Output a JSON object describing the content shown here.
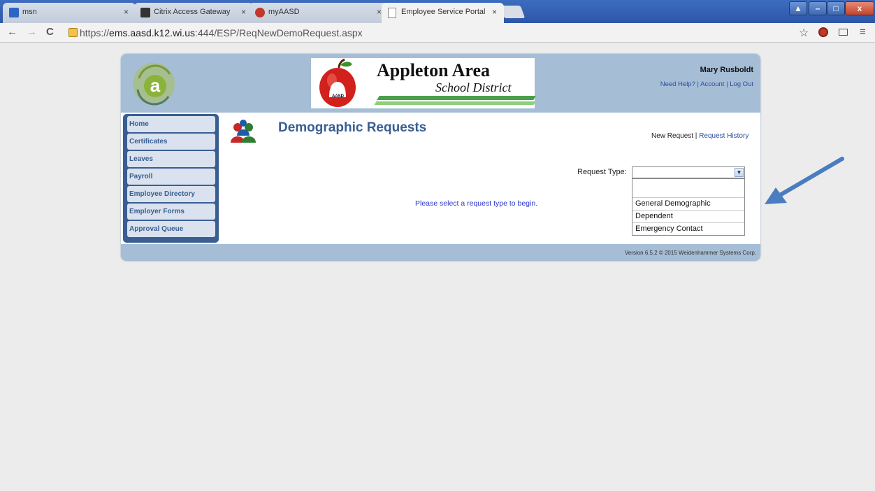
{
  "browser": {
    "tabs": [
      {
        "label": "msn",
        "icon": "msn-icon"
      },
      {
        "label": "Citrix Access Gateway",
        "icon": "citrix-icon"
      },
      {
        "label": "myAASD",
        "icon": "myaasd-icon"
      },
      {
        "label": "Employee Service Portal",
        "icon": "page-icon"
      }
    ],
    "close_glyph": "×",
    "url_prefix": "https://",
    "url_host": "ems.aasd.k12.wi.us",
    "url_path": ":444/ESP/ReqNewDemoRequest.aspx"
  },
  "header": {
    "user_name": "Mary Rusboldt",
    "links": [
      "Need Help?",
      "Account",
      "Log Out"
    ],
    "banner_line1": "Appleton Area",
    "banner_line2": "School District",
    "banner_badge": "AASD"
  },
  "sidebar": {
    "items": [
      {
        "label": "Home"
      },
      {
        "label": "Certificates"
      },
      {
        "label": "Leaves"
      },
      {
        "label": "Payroll"
      },
      {
        "label": "Employee Directory"
      },
      {
        "label": "Employer Forms"
      },
      {
        "label": "Approval Queue"
      }
    ]
  },
  "main": {
    "title": "Demographic Requests",
    "new_request": "New Request",
    "request_history": "Request History",
    "request_type_label": "Request Type:",
    "request_type_value": "",
    "options": [
      "",
      "General Demographic",
      "Dependent",
      "Emergency Contact"
    ],
    "empty_message": "Please select a request type to begin."
  },
  "footer": {
    "version": "Version 6.5.2 © 2015 Weidenhammer Systems Corp."
  },
  "colors": {
    "header_bg": "#a6bdd6",
    "nav_accent": "#3a5e92",
    "link": "#2a4e9a",
    "annotation_arrow": "#4a7cc0"
  }
}
